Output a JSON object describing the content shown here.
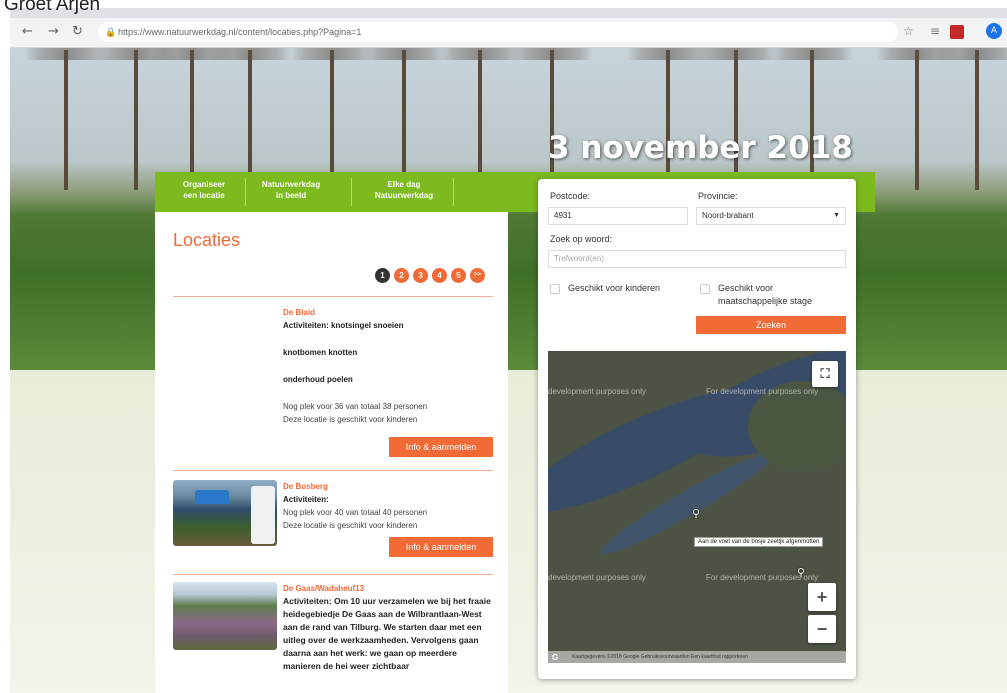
{
  "caption": "Groet Arjen",
  "browser": {
    "url": "https://www.natuurwerkdag.nl/content/locaties.php?Pagina=1",
    "back_icon": "arrow-left-icon",
    "forward_icon": "arrow-right-icon",
    "reload_icon": "reload-icon",
    "lock_icon": "lock-icon",
    "star_icon": "star-icon",
    "profile_initial": "A"
  },
  "hero": {
    "date": "3 november 2018"
  },
  "nav": {
    "items": [
      {
        "line1": "Organiseer",
        "line2": "een locatie"
      },
      {
        "line1": "Natuurwerkdag",
        "line2": "in beeld"
      },
      {
        "line1": "Elke dag",
        "line2": "Natuurwerkdag"
      }
    ],
    "color": "#7cba1e"
  },
  "content": {
    "title": "Locaties",
    "pager": [
      "1",
      "2",
      "3",
      "4",
      "5",
      ">>"
    ],
    "active_page": "1",
    "locations": [
      {
        "name": "De Blaid",
        "activities_label": "Activiteiten: knotsingel snoeien",
        "extra_activities": [
          "knotbomen knotten",
          "onderhoud poelen"
        ],
        "capacity": "Nog plek voor 36 van totaal 38 personen",
        "kids": "Deze locatie is geschikt voor kinderen",
        "button": "Info & aanmelden"
      },
      {
        "name": "De Bosberg",
        "activities_label": "Activiteiten:",
        "capacity": "Nog plek voor 40 van totaal 40 personen",
        "kids": "Deze locatie is geschikt voor kinderen",
        "button": "Info & aanmelden"
      },
      {
        "name": "De Gaas/Wadaheuf13",
        "activities_text": "Activiteiten: Om 10 uur verzamelen we bij het fraaie heidegebiedje De Gaas aan de Wilbrantlaan-West aan de rand van Tilburg. We starten daar met een uitleg over de werkzaamheden. Vervolgens gaan daarna aan het werk: we gaan op meerdere manieren de hei weer zichtbaar"
      }
    ],
    "accent": "#f26a36"
  },
  "search": {
    "postcode_label": "Postcode:",
    "postcode_value": "4931",
    "provincie_label": "Provincie:",
    "provincie_value": "Noord-brabant",
    "zoek_label": "Zoek op woord:",
    "zoek_placeholder": "Trefwoord(en)",
    "kids_label": "Geschikt voor kinderen",
    "stage_label_1": "Geschikt voor",
    "stage_label_2": "maatschappelijke stage",
    "submit": "Zoeken"
  },
  "map": {
    "watermark_1": "development purposes only",
    "watermark_2": "For development purposes only",
    "watermark_3": "development purposes only",
    "watermark_4": "For development purposes only",
    "tooltip": "Aan de voet van de bosje zeeltjk afgenmotten",
    "fullscreen_icon": "fullscreen-icon",
    "zoom_in": "+",
    "zoom_out": "−",
    "attribution": "Kaartgegevens ©2018 Google   Gebruiksvoorwaarden   Een kaartfout rapporteren",
    "logo": "G"
  }
}
